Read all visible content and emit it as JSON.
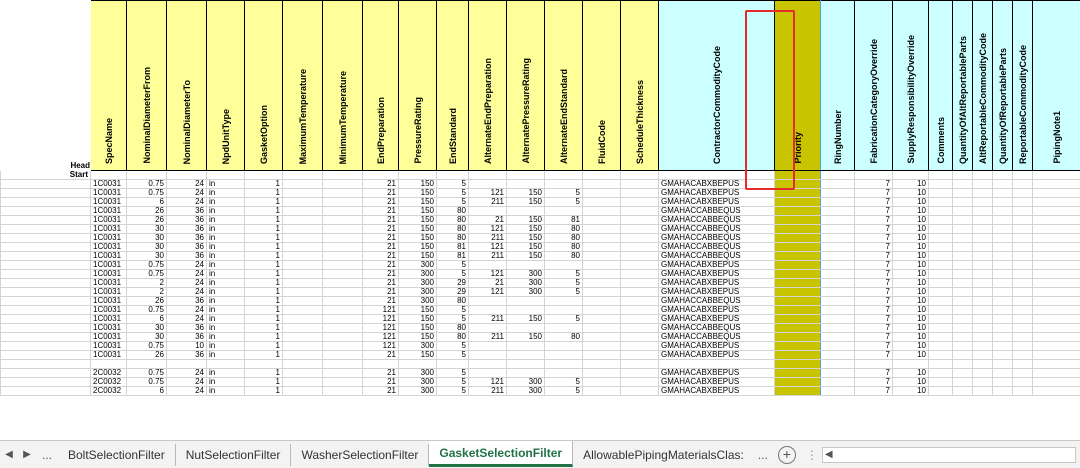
{
  "sheet": {
    "row_labels": {
      "head": "Head",
      "start": "Start"
    },
    "columns": [
      {
        "name": "SpecName",
        "color": "yellow"
      },
      {
        "name": "NominalDiameterFrom",
        "color": "yellow"
      },
      {
        "name": "NominalDiameterTo",
        "color": "yellow"
      },
      {
        "name": "NpdUnitType",
        "color": "yellow"
      },
      {
        "name": "GasketOption",
        "color": "yellow"
      },
      {
        "name": "MaximumTemperature",
        "color": "yellow"
      },
      {
        "name": "MinimumTemperature",
        "color": "yellow"
      },
      {
        "name": "EndPreparation",
        "color": "yellow"
      },
      {
        "name": "PressureRating",
        "color": "yellow"
      },
      {
        "name": "EndStandard",
        "color": "yellow"
      },
      {
        "name": "AlternateEndPreparation",
        "color": "yellow"
      },
      {
        "name": "AlternatePressureRating",
        "color": "yellow"
      },
      {
        "name": "AlternateEndStandard",
        "color": "yellow"
      },
      {
        "name": "FluidCode",
        "color": "yellow"
      },
      {
        "name": "ScheduleThickness",
        "color": "yellow"
      },
      {
        "name": "ContractorCommodityCode",
        "color": "cyan"
      },
      {
        "name": "Priority",
        "color": "olive"
      },
      {
        "name": "RingNumber",
        "color": "cyan"
      },
      {
        "name": "FabricationCategoryOverride",
        "color": "cyan"
      },
      {
        "name": "SupplyResponsibilityOverride",
        "color": "cyan"
      },
      {
        "name": "Comments",
        "color": "cyan"
      },
      {
        "name": "QuantityOfAltReportableParts",
        "color": "cyan"
      },
      {
        "name": "AltReportableCommodityCode",
        "color": "cyan"
      },
      {
        "name": "QuantityOfReportableParts",
        "color": "cyan"
      },
      {
        "name": "ReportableCommodityCode",
        "color": "cyan"
      },
      {
        "name": "PipingNote1",
        "color": "cyan"
      }
    ],
    "rows": [
      [
        "1C0031",
        "0.75",
        "24",
        "in",
        "1",
        "",
        "",
        "21",
        "150",
        "5",
        "",
        "",
        "",
        "",
        "",
        "GMAHACABXBEPUS",
        "",
        "",
        "7",
        "10"
      ],
      [
        "1C0031",
        "0.75",
        "24",
        "in",
        "1",
        "",
        "",
        "21",
        "150",
        "5",
        "121",
        "150",
        "5",
        "",
        "",
        "GMAHACABXBEPUS",
        "",
        "",
        "7",
        "10"
      ],
      [
        "1C0031",
        "6",
        "24",
        "in",
        "1",
        "",
        "",
        "21",
        "150",
        "5",
        "211",
        "150",
        "5",
        "",
        "",
        "GMAHACABXBEPUS",
        "",
        "",
        "7",
        "10"
      ],
      [
        "1C0031",
        "26",
        "36",
        "in",
        "1",
        "",
        "",
        "21",
        "150",
        "80",
        "",
        "",
        "",
        "",
        "",
        "GMAHACCABBEQUS",
        "",
        "",
        "7",
        "10"
      ],
      [
        "1C0031",
        "26",
        "36",
        "in",
        "1",
        "",
        "",
        "21",
        "150",
        "80",
        "21",
        "150",
        "81",
        "",
        "",
        "GMAHACCABBEQUS",
        "",
        "",
        "7",
        "10"
      ],
      [
        "1C0031",
        "30",
        "36",
        "in",
        "1",
        "",
        "",
        "21",
        "150",
        "80",
        "121",
        "150",
        "80",
        "",
        "",
        "GMAHACCABBEQUS",
        "",
        "",
        "7",
        "10"
      ],
      [
        "1C0031",
        "30",
        "36",
        "in",
        "1",
        "",
        "",
        "21",
        "150",
        "80",
        "211",
        "150",
        "80",
        "",
        "",
        "GMAHACCABBEQUS",
        "",
        "",
        "7",
        "10"
      ],
      [
        "1C0031",
        "30",
        "36",
        "in",
        "1",
        "",
        "",
        "21",
        "150",
        "81",
        "121",
        "150",
        "80",
        "",
        "",
        "GMAHACCABBEQUS",
        "",
        "",
        "7",
        "10"
      ],
      [
        "1C0031",
        "30",
        "36",
        "in",
        "1",
        "",
        "",
        "21",
        "150",
        "81",
        "211",
        "150",
        "80",
        "",
        "",
        "GMAHACCABBEQUS",
        "",
        "",
        "7",
        "10"
      ],
      [
        "1C0031",
        "0.75",
        "24",
        "in",
        "1",
        "",
        "",
        "21",
        "300",
        "5",
        "",
        "",
        "",
        "",
        "",
        "GMAHACABXBEPUS",
        "",
        "",
        "7",
        "10"
      ],
      [
        "1C0031",
        "0.75",
        "24",
        "in",
        "1",
        "",
        "",
        "21",
        "300",
        "5",
        "121",
        "300",
        "5",
        "",
        "",
        "GMAHACABXBEPUS",
        "",
        "",
        "7",
        "10"
      ],
      [
        "1C0031",
        "2",
        "24",
        "in",
        "1",
        "",
        "",
        "21",
        "300",
        "29",
        "21",
        "300",
        "5",
        "",
        "",
        "GMAHACABXBEPUS",
        "",
        "",
        "7",
        "10"
      ],
      [
        "1C0031",
        "2",
        "24",
        "in",
        "1",
        "",
        "",
        "21",
        "300",
        "29",
        "121",
        "300",
        "5",
        "",
        "",
        "GMAHACABXBEPUS",
        "",
        "",
        "7",
        "10"
      ],
      [
        "1C0031",
        "26",
        "36",
        "in",
        "1",
        "",
        "",
        "21",
        "300",
        "80",
        "",
        "",
        "",
        "",
        "",
        "GMAHACCABBEQUS",
        "",
        "",
        "7",
        "10"
      ],
      [
        "1C0031",
        "0.75",
        "24",
        "in",
        "1",
        "",
        "",
        "121",
        "150",
        "5",
        "",
        "",
        "",
        "",
        "",
        "GMAHACABXBEPUS",
        "",
        "",
        "7",
        "10"
      ],
      [
        "1C0031",
        "6",
        "24",
        "in",
        "1",
        "",
        "",
        "121",
        "150",
        "5",
        "211",
        "150",
        "5",
        "",
        "",
        "GMAHACABXBEPUS",
        "",
        "",
        "7",
        "10"
      ],
      [
        "1C0031",
        "30",
        "36",
        "in",
        "1",
        "",
        "",
        "121",
        "150",
        "80",
        "",
        "",
        "",
        "",
        "",
        "GMAHACCABBEQUS",
        "",
        "",
        "7",
        "10"
      ],
      [
        "1C0031",
        "30",
        "36",
        "in",
        "1",
        "",
        "",
        "121",
        "150",
        "80",
        "211",
        "150",
        "80",
        "",
        "",
        "GMAHACCABBEQUS",
        "",
        "",
        "7",
        "10"
      ],
      [
        "1C0031",
        "0.75",
        "10",
        "in",
        "1",
        "",
        "",
        "121",
        "300",
        "5",
        "",
        "",
        "",
        "",
        "",
        "GMAHACABXBEPUS",
        "",
        "",
        "7",
        "10"
      ],
      [
        "1C0031",
        "26",
        "36",
        "in",
        "1",
        "",
        "",
        "21",
        "150",
        "5",
        "",
        "",
        "",
        "",
        "",
        "GMAHACABXBEPUS",
        "",
        "",
        "7",
        "10"
      ],
      [
        "",
        "",
        "",
        "",
        "",
        "",
        "",
        "",
        "",
        "",
        "",
        "",
        "",
        "",
        "",
        "",
        "",
        "",
        "",
        ""
      ],
      [
        "2C0032",
        "0.75",
        "24",
        "in",
        "1",
        "",
        "",
        "21",
        "300",
        "5",
        "",
        "",
        "",
        "",
        "",
        "GMAHACABXBEPUS",
        "",
        "",
        "7",
        "10"
      ],
      [
        "2C0032",
        "0.75",
        "24",
        "in",
        "1",
        "",
        "",
        "21",
        "300",
        "5",
        "121",
        "300",
        "5",
        "",
        "",
        "GMAHACABXBEPUS",
        "",
        "",
        "7",
        "10"
      ],
      [
        "2C0032",
        "6",
        "24",
        "in",
        "1",
        "",
        "",
        "21",
        "300",
        "5",
        "211",
        "300",
        "5",
        "",
        "",
        "GMAHACABXBEPUS",
        "",
        "",
        "7",
        "10"
      ]
    ]
  },
  "tabbar": {
    "nav_prev": "◀",
    "nav_next": "▶",
    "ellipsis": "...",
    "tabs": [
      {
        "label": "BoltSelectionFilter",
        "active": false
      },
      {
        "label": "NutSelectionFilter",
        "active": false
      },
      {
        "label": "WasherSelectionFilter",
        "active": false
      },
      {
        "label": "GasketSelectionFilter",
        "active": true
      },
      {
        "label": "AllowablePipingMaterialsClas:",
        "active": false
      }
    ],
    "more": "...",
    "add_sheet": "+",
    "scroll_left": "◀"
  },
  "colors": {
    "header_yellow": "#ffff99",
    "header_cyan": "#ccffff",
    "priority_olive": "#c9c400",
    "highlight_red": "#e52b2b",
    "active_tab_green": "#217346"
  }
}
